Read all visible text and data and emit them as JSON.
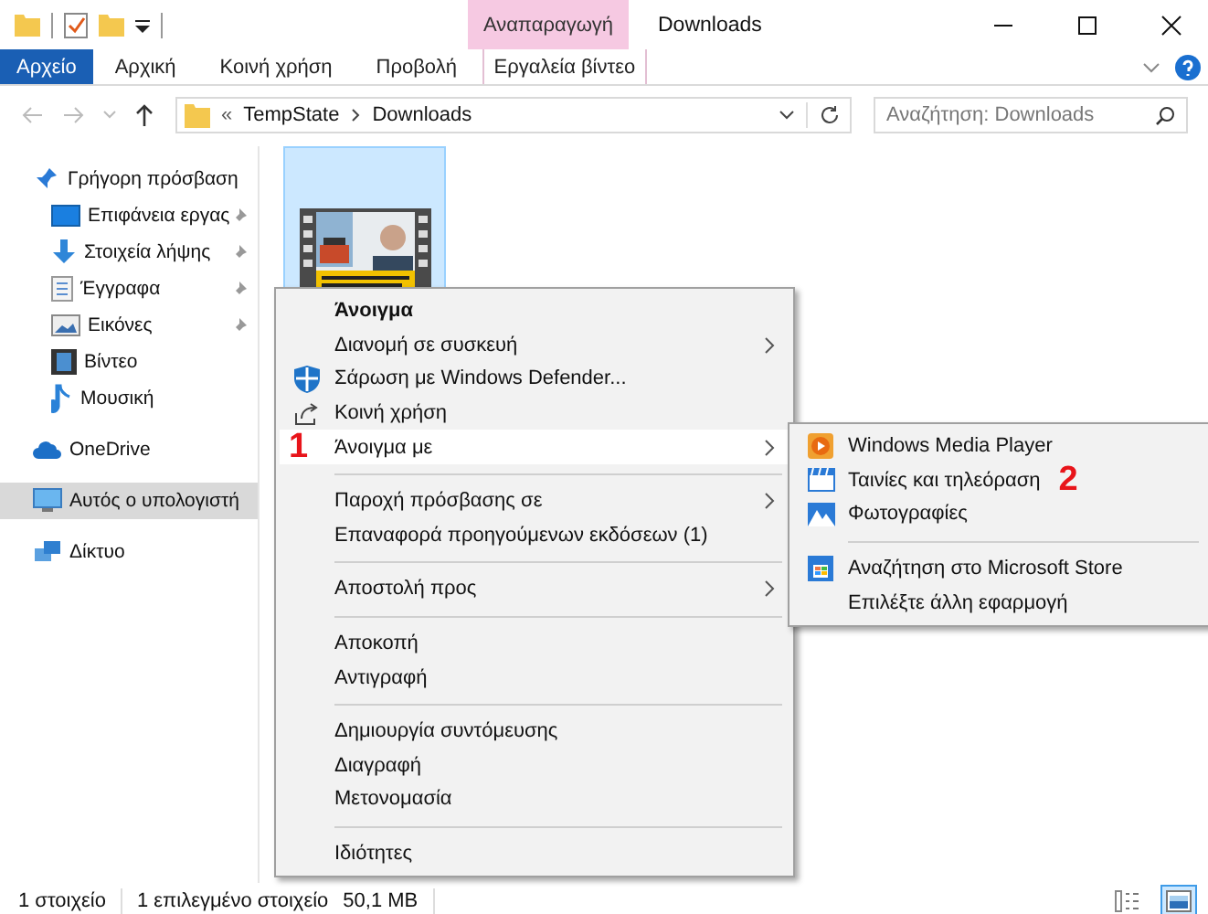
{
  "window": {
    "title": "Downloads",
    "context_group": "Αναπαραγωγή"
  },
  "ribbon_tabs": [
    {
      "label": "Αρχείο",
      "kind": "file",
      "selected": false
    },
    {
      "label": "Αρχική",
      "kind": "normal",
      "selected": false
    },
    {
      "label": "Κοινή χρήση",
      "kind": "normal",
      "selected": false
    },
    {
      "label": "Προβολή",
      "kind": "normal",
      "selected": false
    },
    {
      "label": "Εργαλεία βίντεο",
      "kind": "contextual",
      "selected": false
    }
  ],
  "address": {
    "overflow": "«",
    "path": [
      "TempState",
      "Downloads"
    ]
  },
  "search": {
    "placeholder": "Αναζήτηση: Downloads"
  },
  "sidebar": [
    {
      "label": "Γρήγορη πρόσβαση",
      "kind": "star",
      "selected": false,
      "children": [
        {
          "label": "Επιφάνεια εργας",
          "kind": "desktop",
          "pinned": true,
          "selected": false
        },
        {
          "label": "Στοιχεία λήψης",
          "kind": "download",
          "pinned": true,
          "selected": false
        },
        {
          "label": "Έγγραφα",
          "kind": "documents",
          "pinned": true,
          "selected": false
        },
        {
          "label": "Εικόνες",
          "kind": "pictures",
          "pinned": true,
          "selected": false
        },
        {
          "label": "Βίντεο",
          "kind": "videos",
          "pinned": false,
          "selected": false
        },
        {
          "label": "Μουσική",
          "kind": "music",
          "pinned": false,
          "selected": false
        }
      ]
    },
    {
      "label": "OneDrive",
      "kind": "cloud",
      "selected": false
    },
    {
      "label": "Αυτός ο υπολογιστή",
      "kind": "computer",
      "selected": true
    },
    {
      "label": "Δίκτυο",
      "kind": "network",
      "selected": false
    }
  ],
  "files": [
    {
      "kind": "video",
      "selected": true
    }
  ],
  "context_menu": [
    {
      "kind": "plain",
      "label": "Άνοιγμα",
      "bold": true,
      "selected": false
    },
    {
      "kind": "plain",
      "label": "Διανομή σε συσκευή",
      "submenu": true,
      "selected": false
    },
    {
      "kind": "shield",
      "label": "Σάρωση με Windows Defender...",
      "selected": false
    },
    {
      "kind": "share",
      "label": "Κοινή χρήση",
      "selected": false
    },
    {
      "kind": "plain",
      "label": "Άνοιγμα με",
      "submenu": true,
      "selected": true,
      "annotation": "1"
    },
    {
      "kind": "separator"
    },
    {
      "kind": "plain",
      "label": "Παροχή πρόσβασης σε",
      "submenu": true,
      "selected": false
    },
    {
      "kind": "plain",
      "label": "Επαναφορά προηγούμενων εκδόσεων (1)",
      "selected": false
    },
    {
      "kind": "separator"
    },
    {
      "kind": "plain",
      "label": "Αποστολή προς",
      "submenu": true,
      "selected": false
    },
    {
      "kind": "separator"
    },
    {
      "kind": "plain",
      "label": "Αποκοπή",
      "selected": false
    },
    {
      "kind": "plain",
      "label": "Αντιγραφή",
      "selected": false
    },
    {
      "kind": "separator"
    },
    {
      "kind": "plain",
      "label": "Δημιουργία συντόμευσης",
      "selected": false
    },
    {
      "kind": "plain",
      "label": "Διαγραφή",
      "selected": false
    },
    {
      "kind": "plain",
      "label": "Μετονομασία",
      "selected": false
    },
    {
      "kind": "separator"
    },
    {
      "kind": "plain",
      "label": "Ιδιότητες",
      "selected": false
    }
  ],
  "open_with_menu": [
    {
      "kind": "player",
      "label": "Windows Media Player"
    },
    {
      "kind": "clapper",
      "label": "Ταινίες και τηλεόραση",
      "annotation": "2"
    },
    {
      "kind": "photos",
      "label": "Φωτογραφίες"
    },
    {
      "kind": "separator"
    },
    {
      "kind": "store",
      "label": "Αναζήτηση στο Microsoft Store"
    },
    {
      "kind": "plain",
      "label": "Επιλέξτε άλλη εφαρμογή"
    }
  ],
  "status_bar": {
    "count": "1 στοιχείο",
    "selection": "1 επιλεγμένο στοιχείο",
    "size": "50,1 MB",
    "views": [
      {
        "kind": "details",
        "selected": false
      },
      {
        "kind": "large",
        "selected": true
      }
    ]
  }
}
